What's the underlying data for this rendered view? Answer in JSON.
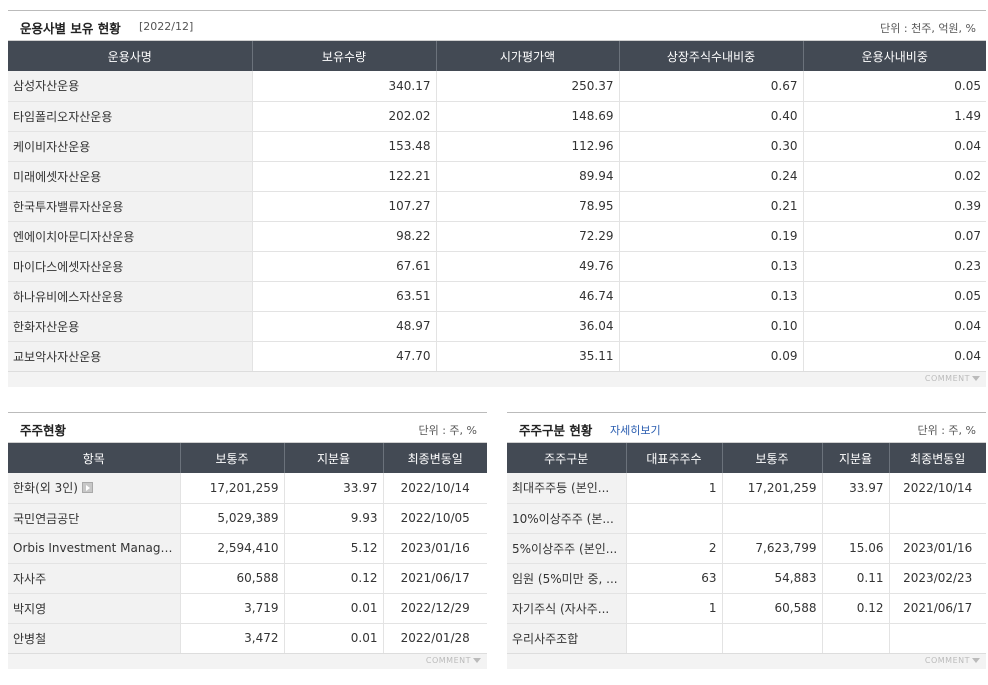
{
  "asset_mgmt": {
    "title": "운용사별 보유 현황",
    "period": "[2022/12]",
    "unit": "단위 : 천주, 억원, %",
    "headers": [
      "운용사명",
      "보유수량",
      "시가평가액",
      "상장주식수내비중",
      "운용사내비중"
    ],
    "rows": [
      {
        "name": "삼성자산운용",
        "qty": "340.17",
        "value": "250.37",
        "listed_ratio": "0.67",
        "fund_ratio": "0.05"
      },
      {
        "name": "타임폴리오자산운용",
        "qty": "202.02",
        "value": "148.69",
        "listed_ratio": "0.40",
        "fund_ratio": "1.49"
      },
      {
        "name": "케이비자산운용",
        "qty": "153.48",
        "value": "112.96",
        "listed_ratio": "0.30",
        "fund_ratio": "0.04"
      },
      {
        "name": "미래에셋자산운용",
        "qty": "122.21",
        "value": "89.94",
        "listed_ratio": "0.24",
        "fund_ratio": "0.02"
      },
      {
        "name": "한국투자밸류자산운용",
        "qty": "107.27",
        "value": "78.95",
        "listed_ratio": "0.21",
        "fund_ratio": "0.39"
      },
      {
        "name": "엔에이치아문디자산운용",
        "qty": "98.22",
        "value": "72.29",
        "listed_ratio": "0.19",
        "fund_ratio": "0.07"
      },
      {
        "name": "마이다스에셋자산운용",
        "qty": "67.61",
        "value": "49.76",
        "listed_ratio": "0.13",
        "fund_ratio": "0.23"
      },
      {
        "name": "하나유비에스자산운용",
        "qty": "63.51",
        "value": "46.74",
        "listed_ratio": "0.13",
        "fund_ratio": "0.05"
      },
      {
        "name": "한화자산운용",
        "qty": "48.97",
        "value": "36.04",
        "listed_ratio": "0.10",
        "fund_ratio": "0.04"
      },
      {
        "name": "교보악사자산운용",
        "qty": "47.70",
        "value": "35.11",
        "listed_ratio": "0.09",
        "fund_ratio": "0.04"
      }
    ],
    "comment_label": "COMMENT"
  },
  "shareholders": {
    "title": "주주현황",
    "unit": "단위 : 주, %",
    "headers": [
      "항목",
      "보통주",
      "지분율",
      "최종변동일"
    ],
    "rows": [
      {
        "name": "한화(외 3인)",
        "shares": "17,201,259",
        "ratio": "33.97",
        "date": "2022/10/14"
      },
      {
        "name": "국민연금공단",
        "shares": "5,029,389",
        "ratio": "9.93",
        "date": "2022/10/05"
      },
      {
        "name": "Orbis Investment Management",
        "shares": "2,594,410",
        "ratio": "5.12",
        "date": "2023/01/16"
      },
      {
        "name": "자사주",
        "shares": "60,588",
        "ratio": "0.12",
        "date": "2021/06/17"
      },
      {
        "name": "박지영",
        "shares": "3,719",
        "ratio": "0.01",
        "date": "2022/12/29"
      },
      {
        "name": "안병철",
        "shares": "3,472",
        "ratio": "0.01",
        "date": "2022/01/28"
      }
    ],
    "comment_label": "COMMENT"
  },
  "shareholder_types": {
    "title": "주주구분 현황",
    "detail_link": "자세히보기",
    "unit": "단위 : 주, %",
    "headers": [
      "주주구분",
      "대표주주수",
      "보통주",
      "지분율",
      "최종변동일"
    ],
    "rows": [
      {
        "name": "최대주주등 (본인...",
        "count": "1",
        "shares": "17,201,259",
        "ratio": "33.97",
        "date": "2022/10/14"
      },
      {
        "name": "10%이상주주 (본...",
        "count": "",
        "shares": "",
        "ratio": "",
        "date": ""
      },
      {
        "name": "5%이상주주 (본인...",
        "count": "2",
        "shares": "7,623,799",
        "ratio": "15.06",
        "date": "2023/01/16"
      },
      {
        "name": "임원 (5%미만 중, ...",
        "count": "63",
        "shares": "54,883",
        "ratio": "0.11",
        "date": "2023/02/23"
      },
      {
        "name": "자기주식 (자사주...",
        "count": "1",
        "shares": "60,588",
        "ratio": "0.12",
        "date": "2021/06/17"
      },
      {
        "name": "우리사주조합",
        "count": "",
        "shares": "",
        "ratio": "",
        "date": ""
      }
    ],
    "comment_label": "COMMENT"
  }
}
